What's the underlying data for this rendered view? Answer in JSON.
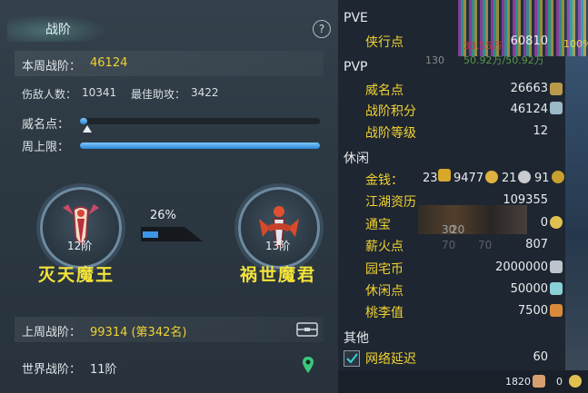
{
  "panel": {
    "title": "战阶",
    "help": "?",
    "weekly_label": "本周战阶：",
    "weekly_value": "46124",
    "kills_label": "伤敌人数：",
    "kills_value": "10341",
    "assist_label": "最佳助攻：",
    "assist_value": "3422",
    "fame_label": "威名点：",
    "fame_progress": 0.03,
    "cap_label": "周上限：",
    "cap_progress": 1.0,
    "progress_percent": "26%",
    "progress_fraction": 0.26,
    "current_rank": {
      "level": "12阶",
      "name": "灭天魔王"
    },
    "next_rank": {
      "level": "13阶",
      "name": "祸世魔君"
    },
    "last_week_label": "上周战阶：",
    "last_week_value": "99314 (第342名)",
    "world_label": "世界战阶：",
    "world_value": "11阶"
  },
  "stats": {
    "pve_header": "PVE",
    "pve_items": [
      {
        "label": "侠行点",
        "value": "60810"
      }
    ],
    "pvp_header": "PVP",
    "pvp_items": [
      {
        "label": "威名点",
        "value": "26663"
      },
      {
        "label": "战阶积分",
        "value": "46124"
      },
      {
        "label": "战阶等级",
        "value": "12"
      }
    ],
    "leisure_header": "休闲",
    "money_label": "金钱：",
    "money": {
      "gold_big": "23",
      "gold": "9477",
      "silver": "21",
      "copper": "91"
    },
    "leisure_items": [
      {
        "label": "江湖资历",
        "value": "109355"
      },
      {
        "label": "通宝",
        "value": "0"
      },
      {
        "label": "薪火点",
        "value": "807"
      },
      {
        "label": "园宅币",
        "value": "2000000"
      },
      {
        "label": "休闲点",
        "value": "50000"
      },
      {
        "label": "桃李值",
        "value": "7500"
      }
    ],
    "other_header": "其他",
    "latency_label": "网络延迟",
    "latency_value": "60",
    "overlay_text_1": "33.55万",
    "overlay_text_2": "50.92万/50.92万",
    "overlay_level": "130",
    "overlay_pct": "100%",
    "bg_num_1": "30",
    "bg_num_2": "20",
    "bg_num_3": "70",
    "bg_num_4": "70"
  },
  "footer": {
    "count": "1820",
    "coins": "0"
  },
  "colors": {
    "accent_yellow": "#f0d232",
    "bar_blue": "#2c86d6"
  }
}
